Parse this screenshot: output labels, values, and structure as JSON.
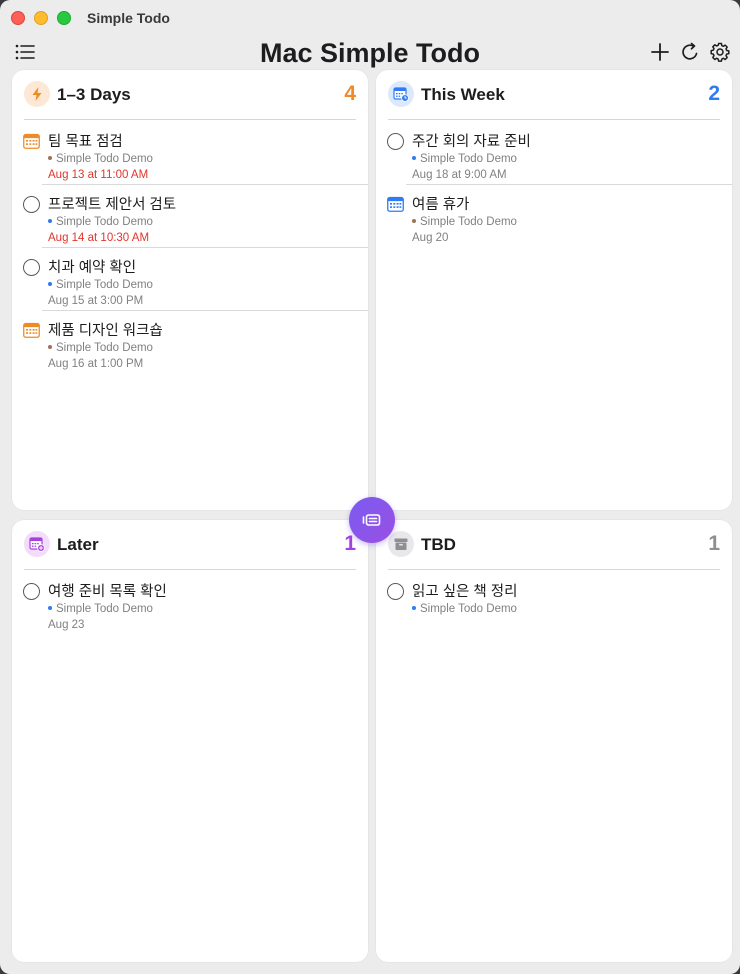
{
  "window": {
    "title": "Simple Todo"
  },
  "header": {
    "title": "Mac Simple Todo",
    "menu_icon": "list-icon",
    "add_icon": "plus-icon",
    "refresh_icon": "refresh-icon",
    "settings_icon": "gear-icon"
  },
  "colors": {
    "orange": "#f08a24",
    "blue": "#2f7bf5",
    "purple": "#a640e0",
    "gray": "#8e8e93",
    "red": "#e0352b",
    "dot_brown": "#a0705a",
    "dot_blue": "#2f7bf5"
  },
  "sections": [
    {
      "title": "1–3 Days",
      "count": "4",
      "icon": "bolt-icon",
      "items": [
        {
          "title": "팀 목표 점검",
          "list": "Simple Todo Demo",
          "date": "Aug 13 at 11:00 AM",
          "kind": "calendar-icon",
          "overdue": true
        },
        {
          "title": "프로젝트 제안서 검토",
          "list": "Simple Todo Demo",
          "date": "Aug 14 at 10:30 AM",
          "kind": "checkbox",
          "overdue": true
        },
        {
          "title": "치과 예약 확인",
          "list": "Simple Todo Demo",
          "date": "Aug 15 at 3:00 PM",
          "kind": "checkbox",
          "overdue": false
        },
        {
          "title": "제품 디자인 워크숍",
          "list": "Simple Todo Demo",
          "date": "Aug 16 at 1:00 PM",
          "kind": "calendar-icon",
          "overdue": false
        }
      ]
    },
    {
      "title": "This Week",
      "count": "2",
      "icon": "calendar-clock-icon",
      "items": [
        {
          "title": "주간 회의 자료 준비",
          "list": "Simple Todo Demo",
          "date": "Aug 18 at 9:00 AM",
          "kind": "checkbox",
          "overdue": false
        },
        {
          "title": "여름 휴가",
          "list": "Simple Todo Demo",
          "date": "Aug 20",
          "kind": "calendar-icon",
          "overdue": false
        }
      ]
    },
    {
      "title": "Later",
      "count": "1",
      "icon": "calendar-plus-icon",
      "items": [
        {
          "title": "여행 준비 목록 확인",
          "list": "Simple Todo Demo",
          "date": "Aug 23",
          "kind": "checkbox",
          "overdue": false
        }
      ]
    },
    {
      "title": "TBD",
      "count": "1",
      "icon": "archive-box-icon",
      "items": [
        {
          "title": "읽고 싶은 책 정리",
          "list": "Simple Todo Demo",
          "date": "",
          "kind": "checkbox",
          "overdue": false
        }
      ]
    }
  ],
  "fab": {
    "icon": "view-switch-icon"
  }
}
